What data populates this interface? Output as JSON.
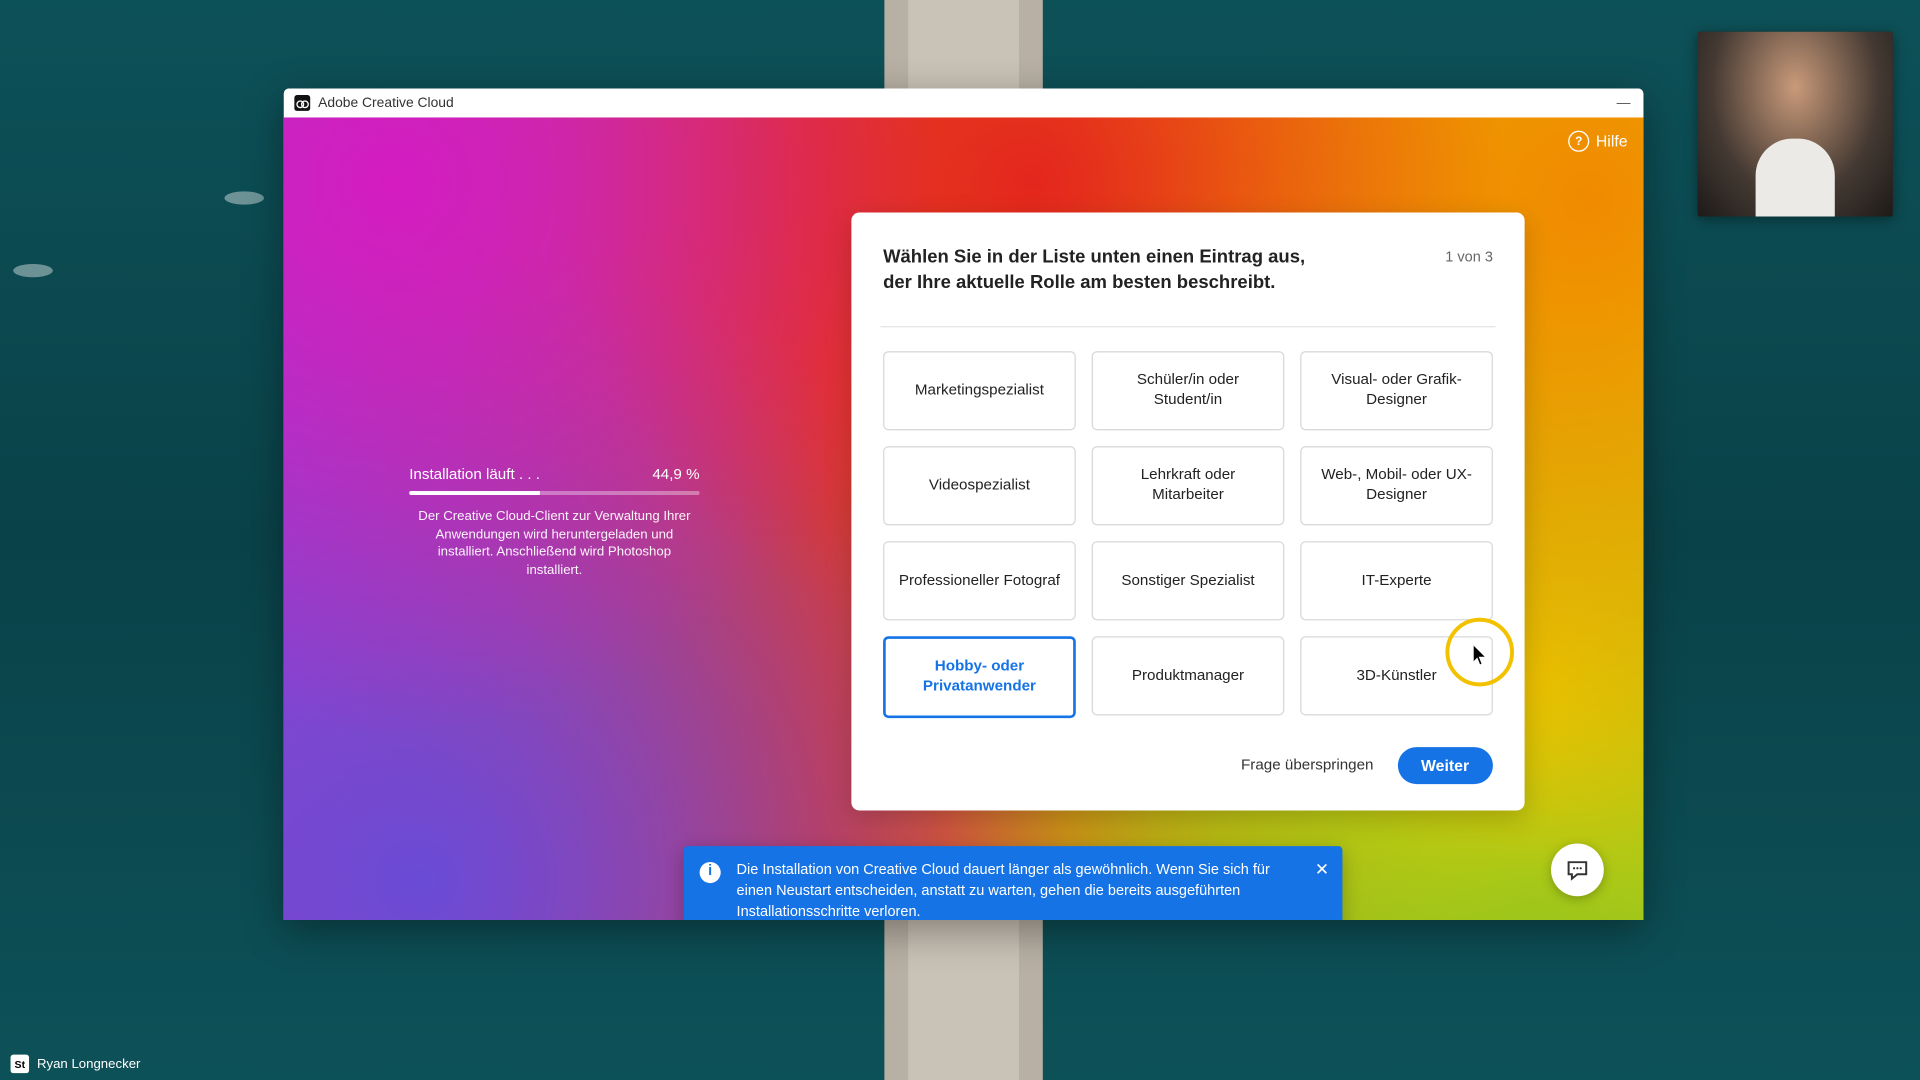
{
  "desktop": {
    "attribution_label": "Ryan Longnecker",
    "stock_badge": "St"
  },
  "window": {
    "title": "Adobe Creative Cloud",
    "help_label": "Hilfe"
  },
  "installer": {
    "status_label": "Installation läuft . . .",
    "percent_label": "44,9 %",
    "percent_value": 44.9,
    "description": "Der Creative Cloud-Client zur Verwaltung Ihrer Anwendungen wird heruntergeladen und installiert. Anschließend wird Photoshop installiert."
  },
  "survey": {
    "heading": "Wählen Sie in der Liste unten einen Eintrag aus, der Ihre aktuelle Rolle am besten beschreibt.",
    "step_label": "1 von 3",
    "options": [
      "Marketingspezialist",
      "Schüler/in oder Student/in",
      "Visual- oder Grafik-Designer",
      "Videospezialist",
      "Lehrkraft oder Mitarbeiter",
      "Web-, Mobil- oder UX-Designer",
      "Professioneller Fotograf",
      "Sonstiger Spezialist",
      "IT-Experte",
      "Hobby- oder Privatanwender",
      "Produktmanager",
      "3D-Künstler"
    ],
    "selected_index": 9,
    "skip_label": "Frage überspringen",
    "next_label": "Weiter"
  },
  "toast": {
    "message": "Die Installation von Creative Cloud dauert länger als gewöhnlich. Wenn Sie sich für einen Neustart entscheiden, anstatt zu warten, gehen die bereits ausgeführten Installationsschritte verloren."
  }
}
